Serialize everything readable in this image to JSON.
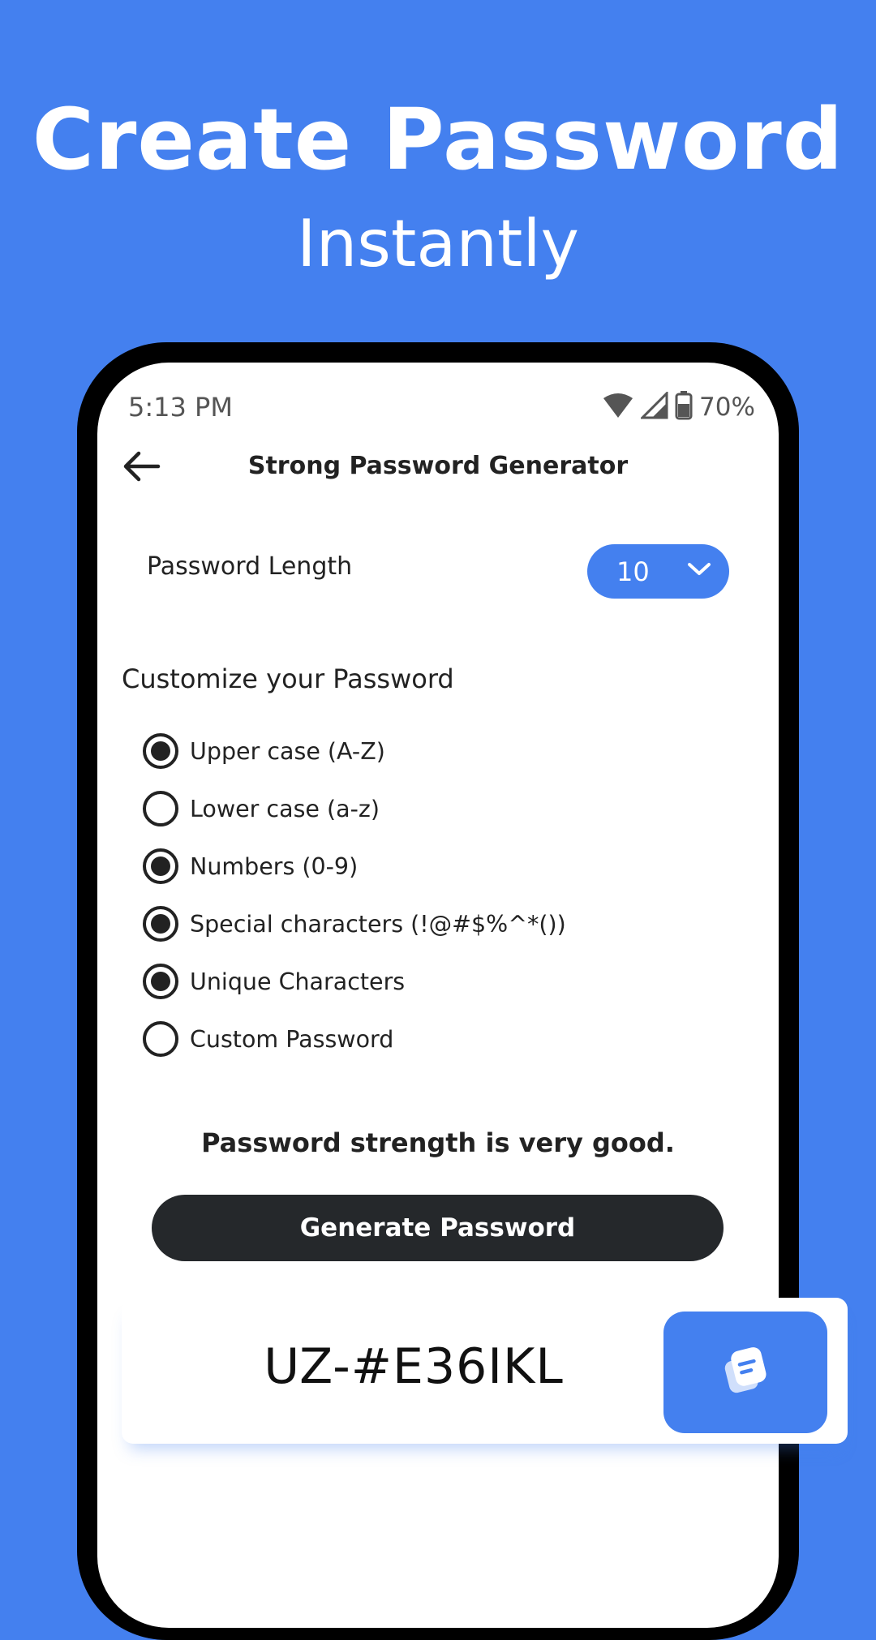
{
  "promo": {
    "headline": "Create Password",
    "subline": "Instantly"
  },
  "status_bar": {
    "time": "5:13 PM",
    "battery": "70%",
    "icons": [
      "wifi-icon",
      "signal-icon",
      "battery-icon"
    ]
  },
  "app_bar": {
    "title": "Strong Password Generator",
    "back_icon": "back-arrow-icon"
  },
  "length": {
    "label": "Password Length",
    "value": "10",
    "icon": "chevron-down-icon"
  },
  "customize": {
    "heading": "Customize your Password",
    "options": [
      {
        "label": "Upper case (A-Z)",
        "checked": true
      },
      {
        "label": "Lower case (a-z)",
        "checked": false
      },
      {
        "label": "Numbers (0-9)",
        "checked": true
      },
      {
        "label": "Special characters (!@#$%^*())",
        "checked": true
      },
      {
        "label": "Unique Characters",
        "checked": true
      },
      {
        "label": "Custom Password",
        "checked": false
      }
    ]
  },
  "strength_text": "Password strength is very good.",
  "generate_label": "Generate Password",
  "result": {
    "password": "UZ-#E36IKL",
    "copy_icon": "copy-icon"
  },
  "colors": {
    "accent": "#4480ef",
    "button_dark": "#25282b"
  }
}
